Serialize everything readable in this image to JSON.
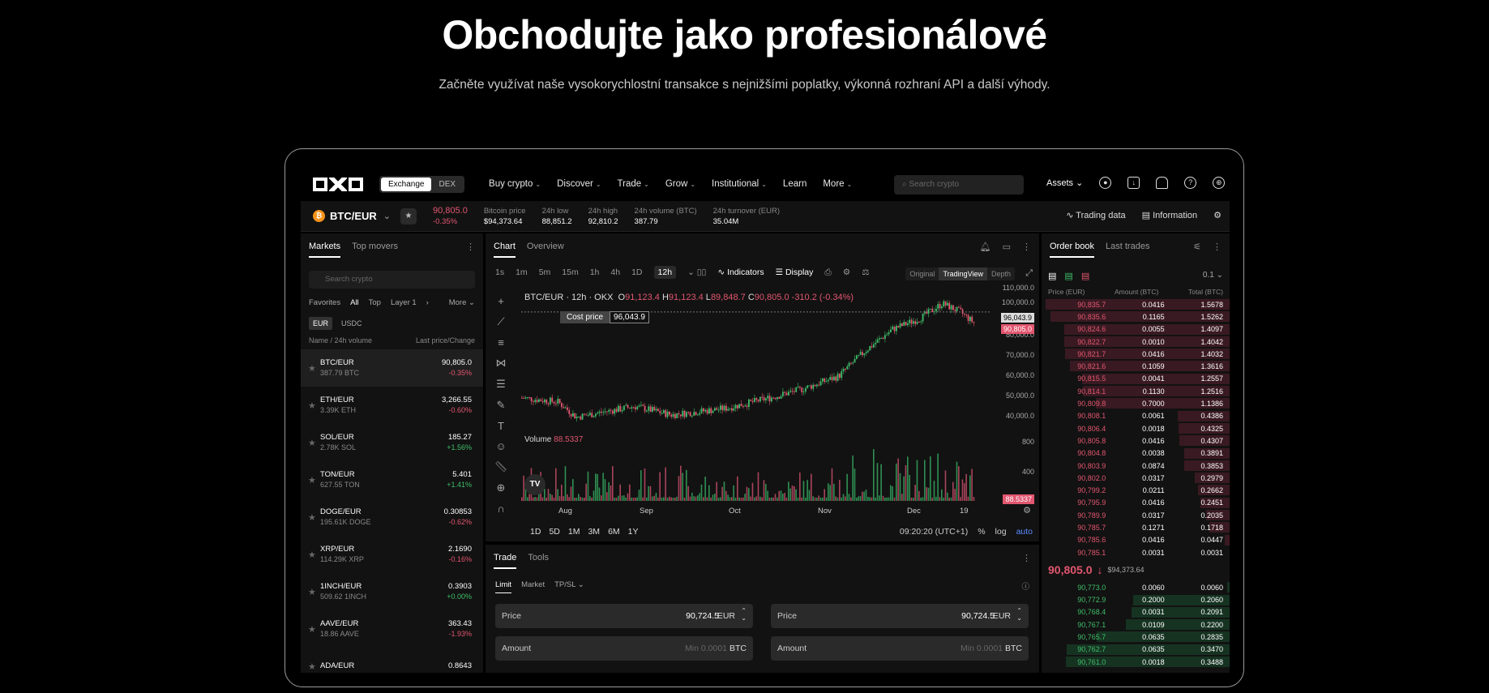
{
  "hero": {
    "title": "Obchodujte jako profesionálové",
    "subtitle": "Začněte využívat naše vysokorychlostní transakce s nejnižšími poplatky, výkonná rozhraní API a další výhody."
  },
  "nav": {
    "mode": [
      "Exchange",
      "DEX"
    ],
    "items": [
      "Buy crypto",
      "Discover",
      "Trade",
      "Grow",
      "Institutional",
      "Learn",
      "More"
    ],
    "search_placeholder": "Search crypto",
    "assets": "Assets"
  },
  "ticker": {
    "pair": "BTC/EUR",
    "price": "90,805.0",
    "change": "-0.35%",
    "stats": [
      {
        "label": "Bitcoin price",
        "value": "$94,373.64"
      },
      {
        "label": "24h low",
        "value": "88,851.2"
      },
      {
        "label": "24h high",
        "value": "92,810.2"
      },
      {
        "label": "24h volume (BTC)",
        "value": "387.79"
      },
      {
        "label": "24h turnover (EUR)",
        "value": "35.04M"
      }
    ],
    "trading_data": "Trading data",
    "information": "Information"
  },
  "markets": {
    "tabs": [
      "Markets",
      "Top movers"
    ],
    "search_placeholder": "Search crypto",
    "filters": [
      "Favorites",
      "All",
      "Top",
      "Layer 1",
      "More"
    ],
    "currencies": [
      "EUR",
      "USDC"
    ],
    "head_left": "Name / 24h volume",
    "head_right": "Last price/Change",
    "rows": [
      {
        "name": "BTC/EUR",
        "vol": "387.79 BTC",
        "price": "90,805.0",
        "change": "-0.35%",
        "dir": "down"
      },
      {
        "name": "ETH/EUR",
        "vol": "3.39K ETH",
        "price": "3,266.55",
        "change": "-0.60%",
        "dir": "down"
      },
      {
        "name": "SOL/EUR",
        "vol": "2.78K SOL",
        "price": "185.27",
        "change": "+1.56%",
        "dir": "up"
      },
      {
        "name": "TON/EUR",
        "vol": "627.55 TON",
        "price": "5.401",
        "change": "+1.41%",
        "dir": "up"
      },
      {
        "name": "DOGE/EUR",
        "vol": "195.61K DOGE",
        "price": "0.30853",
        "change": "-0.62%",
        "dir": "down"
      },
      {
        "name": "XRP/EUR",
        "vol": "114.29K XRP",
        "price": "2.1690",
        "change": "-0.16%",
        "dir": "down"
      },
      {
        "name": "1INCH/EUR",
        "vol": "509.62 1INCH",
        "price": "0.3903",
        "change": "+0.00%",
        "dir": "up"
      },
      {
        "name": "AAVE/EUR",
        "vol": "18.86 AAVE",
        "price": "363.43",
        "change": "-1.93%",
        "dir": "down"
      },
      {
        "name": "ADA/EUR",
        "vol": "",
        "price": "0.8643",
        "change": "",
        "dir": "down"
      }
    ]
  },
  "chart": {
    "tabs": [
      "Chart",
      "Overview"
    ],
    "intervals": [
      "1s",
      "1m",
      "5m",
      "15m",
      "1h",
      "4h",
      "1D",
      "12h"
    ],
    "indicators": "Indicators",
    "display": "Display",
    "views": [
      "Original",
      "TradingView",
      "Depth"
    ],
    "ohlc": {
      "title": "BTC/EUR · 12h · OKX",
      "o": "91,123.4",
      "h": "91,123.4",
      "l": "89,848.7",
      "c": "90,805.0",
      "chg": "-310.2 (-0.34%)"
    },
    "cost_label": "Cost price",
    "cost_value": "96,043.9",
    "price_tag": "90,805.0",
    "y_ticks": [
      "110,000.0",
      "100,000.0",
      "80,000.0",
      "70,000.0",
      "60,000.0",
      "50,000.0",
      "40,000.0"
    ],
    "volume_label": "Volume",
    "volume_value": "88.5337",
    "vol_ticks": [
      "800",
      "400"
    ],
    "months": [
      "Aug",
      "Sep",
      "Oct",
      "Nov",
      "Dec",
      "19"
    ],
    "ranges": [
      "1D",
      "5D",
      "1M",
      "3M",
      "6M",
      "1Y"
    ],
    "time": "09:20:20 (UTC+1)",
    "scale": [
      "%",
      "log",
      "auto"
    ]
  },
  "trade": {
    "tabs": [
      "Trade",
      "Tools"
    ],
    "sub": [
      "Limit",
      "Market",
      "TP/SL"
    ],
    "price_label": "Price",
    "price_value": "90,724.5",
    "price_unit": "EUR",
    "amount_label": "Amount",
    "amount_placeholder": "Min 0.0001",
    "amount_unit": "BTC"
  },
  "book": {
    "tabs": [
      "Order book",
      "Last trades"
    ],
    "step": "0.1",
    "head": [
      "Price (EUR)",
      "Amount (BTC)",
      "Total (BTC)"
    ],
    "asks": [
      [
        "90,835.7",
        "0.0416",
        "1.5678"
      ],
      [
        "90,835.6",
        "0.1165",
        "1.5262"
      ],
      [
        "90,824.6",
        "0.0055",
        "1.4097"
      ],
      [
        "90,822.7",
        "0.0010",
        "1.4042"
      ],
      [
        "90,821.7",
        "0.0416",
        "1.4032"
      ],
      [
        "90,821.6",
        "0.1059",
        "1.3616"
      ],
      [
        "90,815.5",
        "0.0041",
        "1.2557"
      ],
      [
        "90,814.1",
        "0.1130",
        "1.2516"
      ],
      [
        "90,809.8",
        "0.7000",
        "1.1386"
      ],
      [
        "90,808.1",
        "0.0061",
        "0.4386"
      ],
      [
        "90,806.4",
        "0.0018",
        "0.4325"
      ],
      [
        "90,805.8",
        "0.0416",
        "0.4307"
      ],
      [
        "90,804.8",
        "0.0038",
        "0.3891"
      ],
      [
        "90,803.9",
        "0.0874",
        "0.3853"
      ],
      [
        "90,802.0",
        "0.0317",
        "0.2979"
      ],
      [
        "90,799.2",
        "0.0211",
        "0.2662"
      ],
      [
        "90,795.9",
        "0.0416",
        "0.2451"
      ],
      [
        "90,789.9",
        "0.0317",
        "0.2035"
      ],
      [
        "90,785.7",
        "0.1271",
        "0.1718"
      ],
      [
        "90,785.6",
        "0.0416",
        "0.0447"
      ],
      [
        "90,785.1",
        "0.0031",
        "0.0031"
      ]
    ],
    "mid": "90,805.0",
    "mid_usd": "$94,373.64",
    "bids": [
      [
        "90,773.0",
        "0.0060",
        "0.0060"
      ],
      [
        "90,772.9",
        "0.2000",
        "0.2060"
      ],
      [
        "90,768.4",
        "0.0031",
        "0.2091"
      ],
      [
        "90,767.1",
        "0.0109",
        "0.2200"
      ],
      [
        "90,765.7",
        "0.0635",
        "0.2835"
      ],
      [
        "90,762.7",
        "0.0635",
        "0.3470"
      ],
      [
        "90,761.0",
        "0.0018",
        "0.3488"
      ]
    ]
  }
}
